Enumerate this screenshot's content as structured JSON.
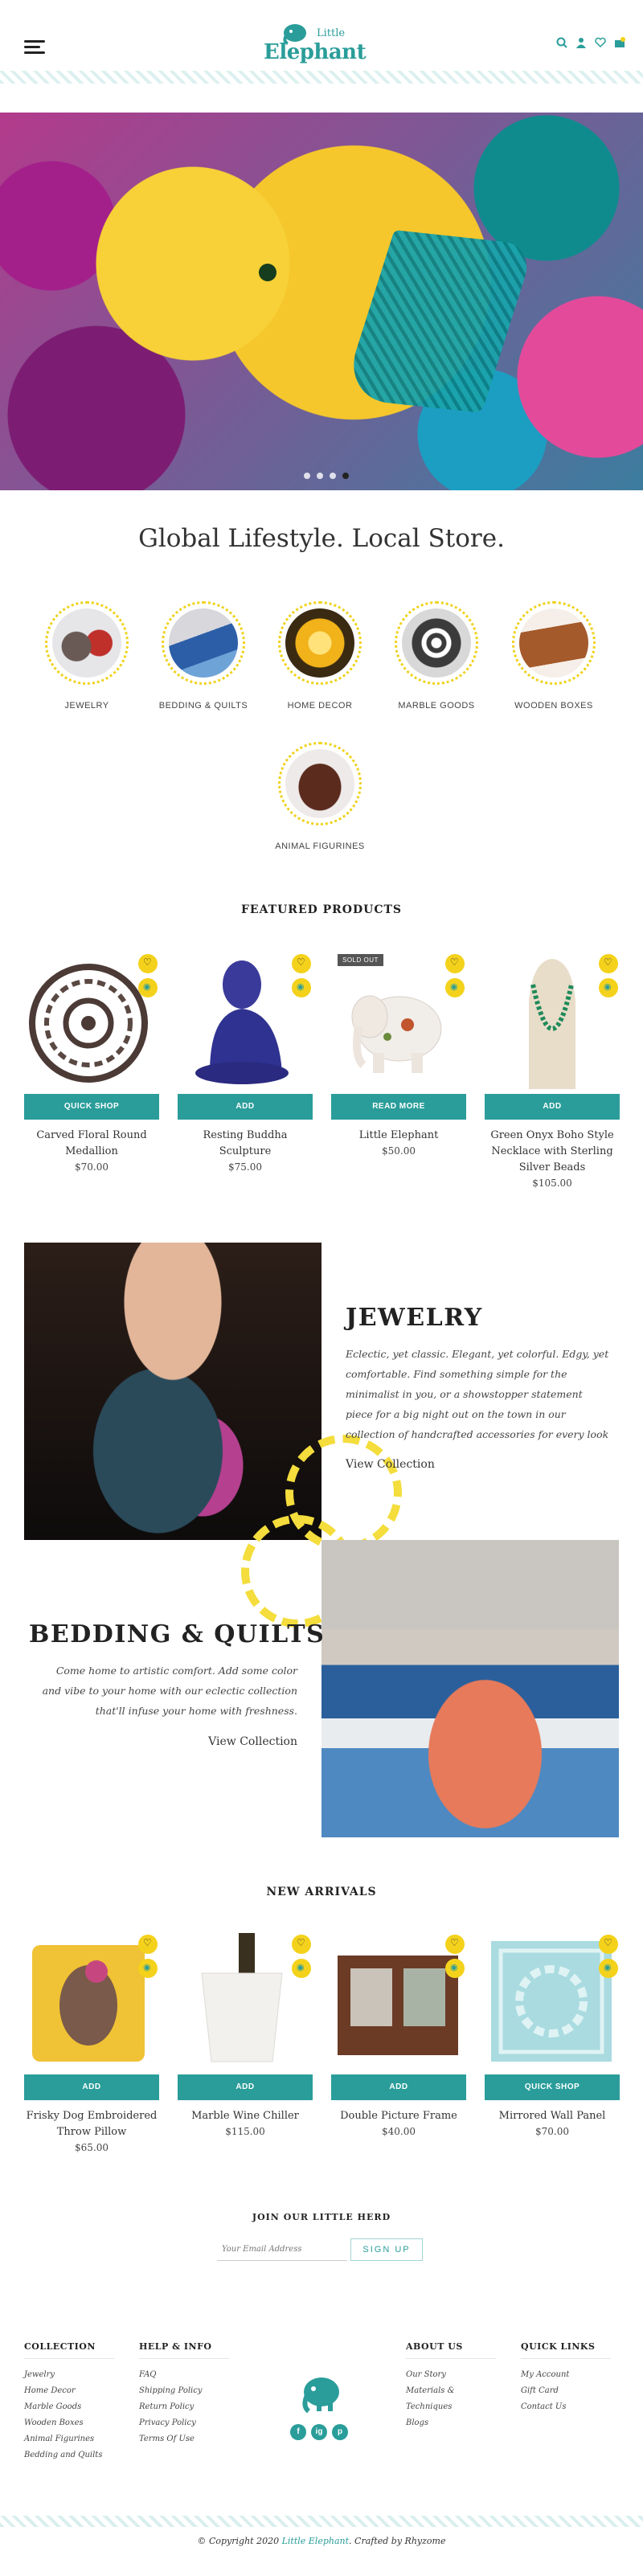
{
  "header": {
    "logo_small": "Little",
    "logo_main": "Elephant",
    "icons": [
      "menu-icon",
      "search-icon",
      "user-icon",
      "heart-icon",
      "cart-icon"
    ],
    "cart_count": "0"
  },
  "hero": {
    "slide_count": 4,
    "active_slide": 4
  },
  "tagline": "Global Lifestyle. Local Store.",
  "categories": [
    {
      "label": "Jewelry"
    },
    {
      "label": "Bedding & Quilts"
    },
    {
      "label": "Home Decor"
    },
    {
      "label": "Marble Goods"
    },
    {
      "label": "Wooden Boxes"
    },
    {
      "label": "Animal Figurines"
    }
  ],
  "featured": {
    "title": "FEATURED PRODUCTS",
    "products": [
      {
        "name": "Carved Floral Round Medallion",
        "price": "$70.00",
        "button": "Quick Shop"
      },
      {
        "name": "Resting Buddha Sculpture",
        "price": "$75.00",
        "button": "Add"
      },
      {
        "name": "Little Elephant",
        "price": "$50.00",
        "button": "Read More",
        "badge": "SOLD OUT"
      },
      {
        "name": "Green Onyx Boho Style Necklace with Sterling Silver Beads",
        "price": "$105.00",
        "button": "Add"
      }
    ]
  },
  "jewelry_block": {
    "title": "JEWELRY",
    "text": "Eclectic, yet classic. Elegant, yet colorful. Edgy, yet comfortable. Find something simple for the minimalist in you, or a showstopper statement piece for a big night out on the town in our collection of handcrafted accessories for every look",
    "link": "View Collection"
  },
  "bedding_block": {
    "title": "BEDDING & QUILTS",
    "text": "Come home to artistic comfort. Add some color and vibe to your home with our eclectic collection that'll infuse your home with freshness.",
    "link": "View Collection"
  },
  "new_arrivals": {
    "title": "NEW ARRIVALS",
    "products": [
      {
        "name": "Frisky Dog Embroidered Throw Pillow",
        "price": "$65.00",
        "button": "Add"
      },
      {
        "name": "Marble Wine Chiller",
        "price": "$115.00",
        "button": "Add"
      },
      {
        "name": "Double Picture Frame",
        "price": "$40.00",
        "button": "Add"
      },
      {
        "name": "Mirrored Wall Panel",
        "price": "$70.00",
        "button": "Quick Shop"
      }
    ]
  },
  "newsletter": {
    "title": "JOIN OUR LITTLE HERD",
    "placeholder": "Your Email Address",
    "button": "SIGN UP"
  },
  "footer": {
    "collection": {
      "title": "COLLECTION",
      "items": [
        "Jewelry",
        "Home Decor",
        "Marble Goods",
        "Wooden Boxes",
        "Animal Figurines",
        "Bedding and Quilts"
      ]
    },
    "help": {
      "title": "HELP & INFO",
      "items": [
        "FAQ",
        "Shipping Policy",
        "Return Policy",
        "Privacy Policy",
        "Terms Of Use"
      ]
    },
    "about": {
      "title": "ABOUT US",
      "items": [
        "Our Story",
        "Materials & Techniques",
        "Blogs"
      ]
    },
    "quick": {
      "title": "QUICK LINKS",
      "items": [
        "My Account",
        "Gift Card",
        "Contact Us"
      ]
    },
    "social": [
      "f",
      "ig",
      "p"
    ],
    "copyright_prefix": "© Copyright 2020",
    "copyright_brand": "Little Elephant",
    "copyright_suffix": ". Crafted by Rhyzome"
  },
  "colors": {
    "accent": "#2a9d9a",
    "highlight": "#f4d21b"
  }
}
